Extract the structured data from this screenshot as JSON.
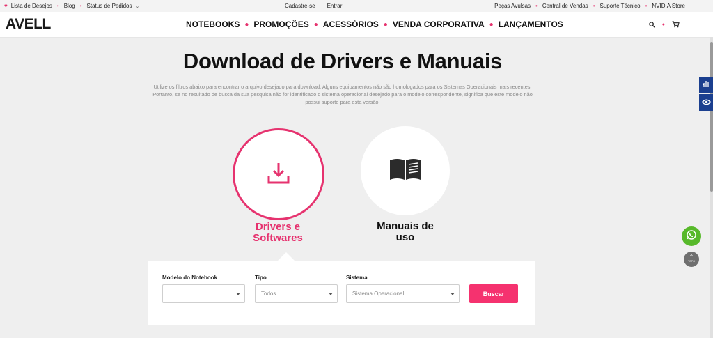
{
  "topbar": {
    "wishlist": "Lista de Desejos",
    "blog": "Blog",
    "order_status": "Status de Pedidos",
    "register": "Cadastre-se",
    "login": "Entrar",
    "spare_parts": "Peças Avulsas",
    "sales_center": "Central de Vendas",
    "tech_support": "Suporte Técnico",
    "nvidia_store": "NVIDIA Store"
  },
  "header": {
    "logo": "AVELL",
    "nav": [
      "NOTEBOOKS",
      "PROMOÇÕES",
      "ACESSÓRIOS",
      "VENDA CORPORATIVA",
      "LANÇAMENTOS"
    ]
  },
  "main": {
    "title": "Download de Drivers e Manuais",
    "description": "Utilize os filtros abaixo para encontrar o arquivo desejado para download. Alguns equipamentos não são homologados para os Sistemas Operacionais mais recentes. Portanto, se no resultado de busca da sua pesquisa não for identificado o sistema operacional desejado para o modelo correspondente, significa que este modelo não possui suporte para esta versão.",
    "options": {
      "drivers_line1": "Drivers e",
      "drivers_line2": "Softwares",
      "manuais_line1": "Manuais de",
      "manuais_line2": "uso"
    }
  },
  "filters": {
    "model_label": "Modelo do Notebook",
    "model_value": "",
    "type_label": "Tipo",
    "type_value": "Todos",
    "system_label": "Sistema",
    "system_value": "Sistema Operacional",
    "search_button": "Buscar"
  },
  "widgets": {
    "back_to_top": "TOPO"
  },
  "colors": {
    "accent": "#e6336f",
    "button": "#f5326f",
    "accessibility": "#1b3f8f",
    "whatsapp": "#57b92a"
  }
}
